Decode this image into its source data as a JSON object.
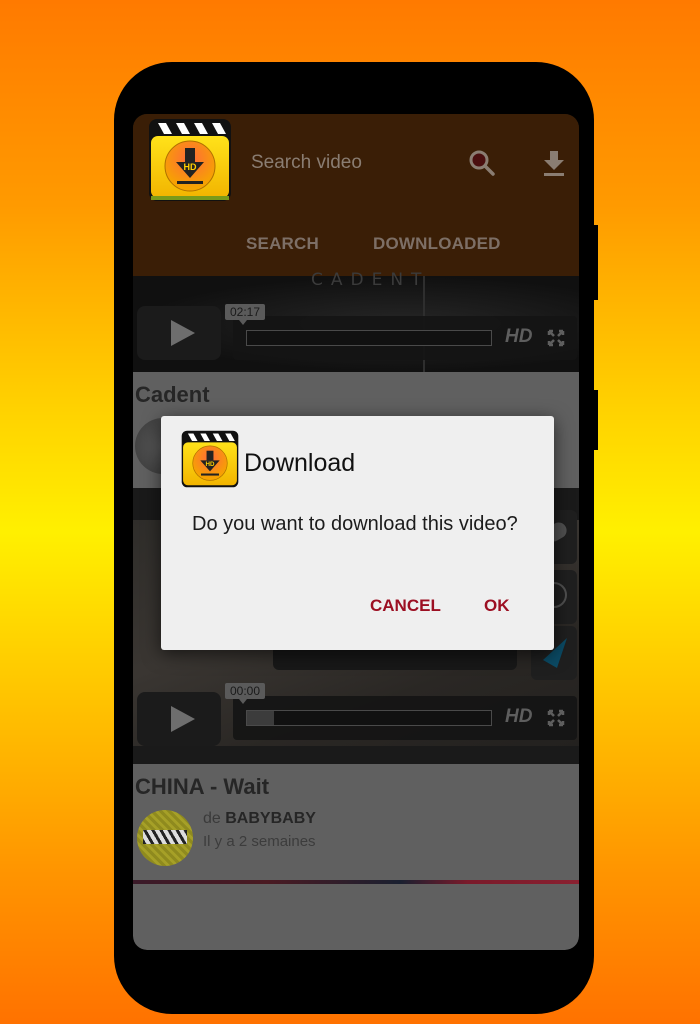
{
  "app": {
    "search_placeholder": "Search video",
    "tabs": [
      {
        "label": "SEARCH",
        "active": false
      },
      {
        "label": "DOWNLOADED",
        "active": false
      }
    ],
    "icons": {
      "logo": "hd-video-download-logo",
      "search": "search-icon",
      "downloads": "download-icon"
    }
  },
  "videos": [
    {
      "thumbnail_text": "CADENT",
      "time": "02:17",
      "progress": 0,
      "quality": "HD",
      "title": "Cadent"
    },
    {
      "time": "00:00",
      "progress": 0.1,
      "quality": "HD",
      "title": "CHINA - Wait",
      "channel_prefix": "de",
      "channel": "BABYBABY",
      "age": "Il y a 2 semaines"
    }
  ],
  "dialog": {
    "title": "Download",
    "message": "Do you want to download this video?",
    "cancel_label": "CANCEL",
    "ok_label": "OK"
  },
  "colors": {
    "appbar": "#3a1e06",
    "dialog_button": "#9c0f22",
    "dialog_bg": "#efefef"
  }
}
